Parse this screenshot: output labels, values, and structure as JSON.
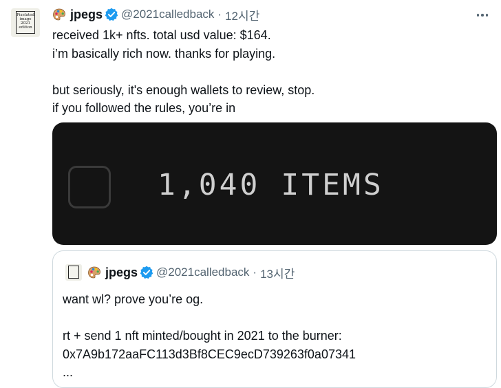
{
  "tweet": {
    "avatar_text": "Pixelated image 2021 edition",
    "display_name": "jpegs",
    "handle": "@2021calledback",
    "separator": "·",
    "time": "12시간",
    "lines": [
      "received 1k+ nfts. total usd value: $164.",
      "i’m basically rich now. thanks for playing.",
      "",
      "but seriously, it's enough wallets to review, stop.",
      "if you followed the rules, you’re in"
    ],
    "media_text": "1,040 ITEMS"
  },
  "quote": {
    "display_name": "jpegs",
    "handle": "@2021calledback",
    "separator": "·",
    "time": "13시간",
    "lines": [
      "want wl? prove you’re og.",
      "",
      "rt + send 1 nft minted/bought in 2021 to the burner:",
      "0x7A9b172aaFC113d3Bf8CEC9ecD739263f0a07341",
      "..."
    ]
  },
  "colors": {
    "verified": "#1d9bf0",
    "secondary_text": "#536471",
    "media_bg": "#141414"
  },
  "icons": [
    "palette-icon",
    "verified-badge-icon",
    "more-options-icon"
  ]
}
